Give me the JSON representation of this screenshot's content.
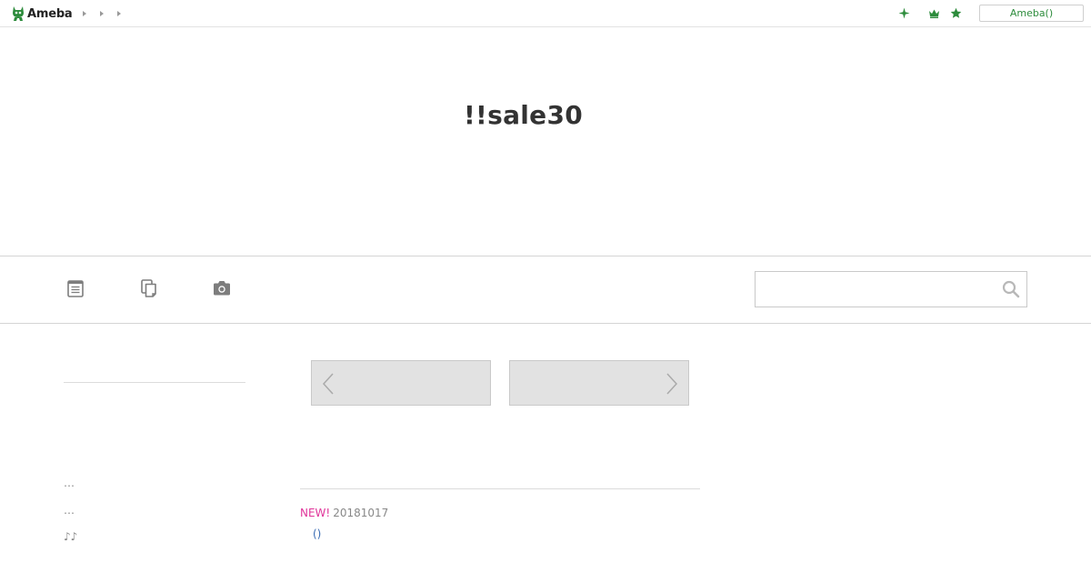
{
  "header": {
    "logo_text": "Ameba",
    "breadcrumbs": [
      "",
      "",
      ""
    ],
    "icons": [
      "sparkle-icon",
      "crown-icon",
      "star-icon"
    ],
    "login_label": "Ameba()",
    "accent_color": "#2d8c3c"
  },
  "blog": {
    "title": "!!sale30"
  },
  "nav": {
    "items": [
      "entries-icon",
      "pages-icon",
      "camera-icon"
    ],
    "search": {
      "value": "",
      "placeholder": ""
    }
  },
  "sidebar": {
    "items": [
      {
        "label": "…"
      },
      {
        "label": "…"
      },
      {
        "label": "♪♪"
      }
    ]
  },
  "pager": {
    "prev_icon": "chevron-left-icon",
    "next_icon": "chevron-right-icon"
  },
  "entries": [
    {
      "badge": "NEW!",
      "date": "20181017",
      "title": "()"
    }
  ],
  "colors": {
    "badge": "#e0359a",
    "link": "#3a6db5",
    "pager_bg": "#e2e2e2"
  }
}
